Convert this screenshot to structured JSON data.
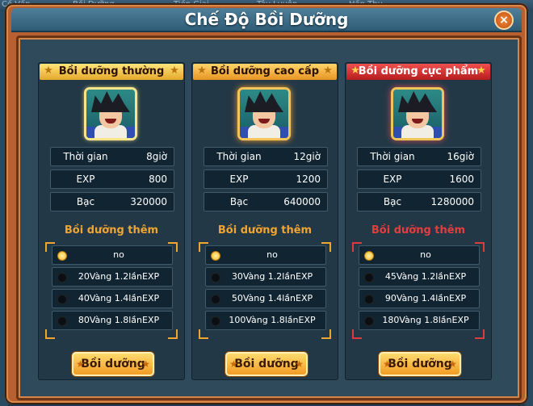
{
  "background": {
    "tabs": [
      "Cố Vấn",
      "Bồi Dưỡng",
      "Tiền Giai",
      "Tây Luyện",
      "Hấp Thu"
    ]
  },
  "window": {
    "title": "Chế Độ Bồi Dưỡng",
    "close_icon": "×"
  },
  "panels": [
    {
      "header": "Bồi dưỡng thường",
      "stats": [
        {
          "label": "Thời gian",
          "value": "8giờ"
        },
        {
          "label": "EXP",
          "value": "800"
        },
        {
          "label": "Bạc",
          "value": "320000"
        }
      ],
      "extra_title": "Bồi dưỡng thêm",
      "options": [
        {
          "text": "no",
          "selected": true
        },
        {
          "text": "20Vàng 1.2lầnEXP",
          "selected": false
        },
        {
          "text": "40Vàng 1.4lầnEXP",
          "selected": false
        },
        {
          "text": "80Vàng 1.8lầnEXP",
          "selected": false
        }
      ],
      "button": "Bồi dưỡng"
    },
    {
      "header": "Bồi dưỡng cao cấp",
      "stats": [
        {
          "label": "Thời gian",
          "value": "12giờ"
        },
        {
          "label": "EXP",
          "value": "1200"
        },
        {
          "label": "Bạc",
          "value": "640000"
        }
      ],
      "extra_title": "Bồi dưỡng thêm",
      "options": [
        {
          "text": "no",
          "selected": true
        },
        {
          "text": "30Vàng 1.2lầnEXP",
          "selected": false
        },
        {
          "text": "50Vàng 1.4lầnEXP",
          "selected": false
        },
        {
          "text": "100Vàng 1.8lầnEXP",
          "selected": false
        }
      ],
      "button": "Bồi dưỡng"
    },
    {
      "header": "Bồi dưỡng cực phẩm",
      "stats": [
        {
          "label": "Thời gian",
          "value": "16giờ"
        },
        {
          "label": "EXP",
          "value": "1600"
        },
        {
          "label": "Bạc",
          "value": "1280000"
        }
      ],
      "extra_title": "Bồi dưỡng thêm",
      "options": [
        {
          "text": "no",
          "selected": true
        },
        {
          "text": "45Vàng 1.2lầnEXP",
          "selected": false
        },
        {
          "text": "90Vàng 1.4lầnEXP",
          "selected": false
        },
        {
          "text": "180Vàng 1.8lầnEXP",
          "selected": false
        }
      ],
      "button": "Bồi dưỡng"
    }
  ],
  "colors": {
    "accent_orange": "#f0a431",
    "accent_red": "#e33d3d",
    "window_frame": "#b8602f",
    "panel_bg": "#223847"
  },
  "icons": [
    "close-icon",
    "star-icon",
    "radio-icon",
    "character-portrait"
  ]
}
